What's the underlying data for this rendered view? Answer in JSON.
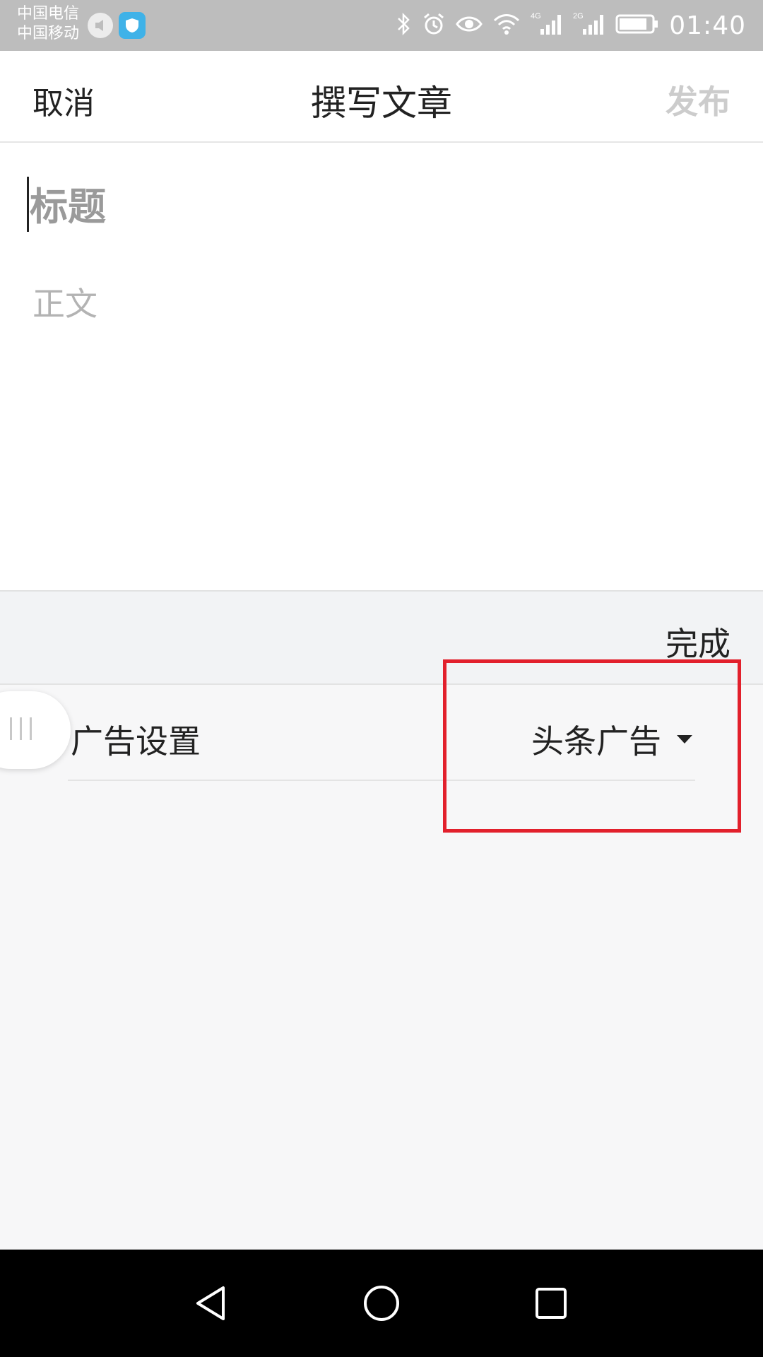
{
  "status_bar": {
    "carrier_1": "中国电信",
    "carrier_2": "中国移动",
    "time": "01:40",
    "icons": [
      "sound-icon",
      "shield-icon",
      "bluetooth-icon",
      "alarm-icon",
      "eye-icon",
      "wifi-icon",
      "signal-4g-icon",
      "signal-2g-icon",
      "battery-icon"
    ],
    "network_labels": [
      "4G",
      "2G"
    ]
  },
  "header": {
    "cancel_label": "取消",
    "title": "撰写文章",
    "publish_label": "发布"
  },
  "editor": {
    "title_placeholder": "标题",
    "body_placeholder": "正文"
  },
  "settings_panel": {
    "done_label": "完成",
    "ad_setting_label": "广告设置",
    "ad_setting_value": "头条广告"
  },
  "colors": {
    "highlight_box": "#e2202c",
    "status_bar_bg": "#bdbdbd",
    "publish_disabled": "#cccccc",
    "panel_bg": "#f7f7f8"
  },
  "nav_bar": {
    "icons": [
      "back-icon",
      "home-icon",
      "recent-apps-icon"
    ]
  }
}
